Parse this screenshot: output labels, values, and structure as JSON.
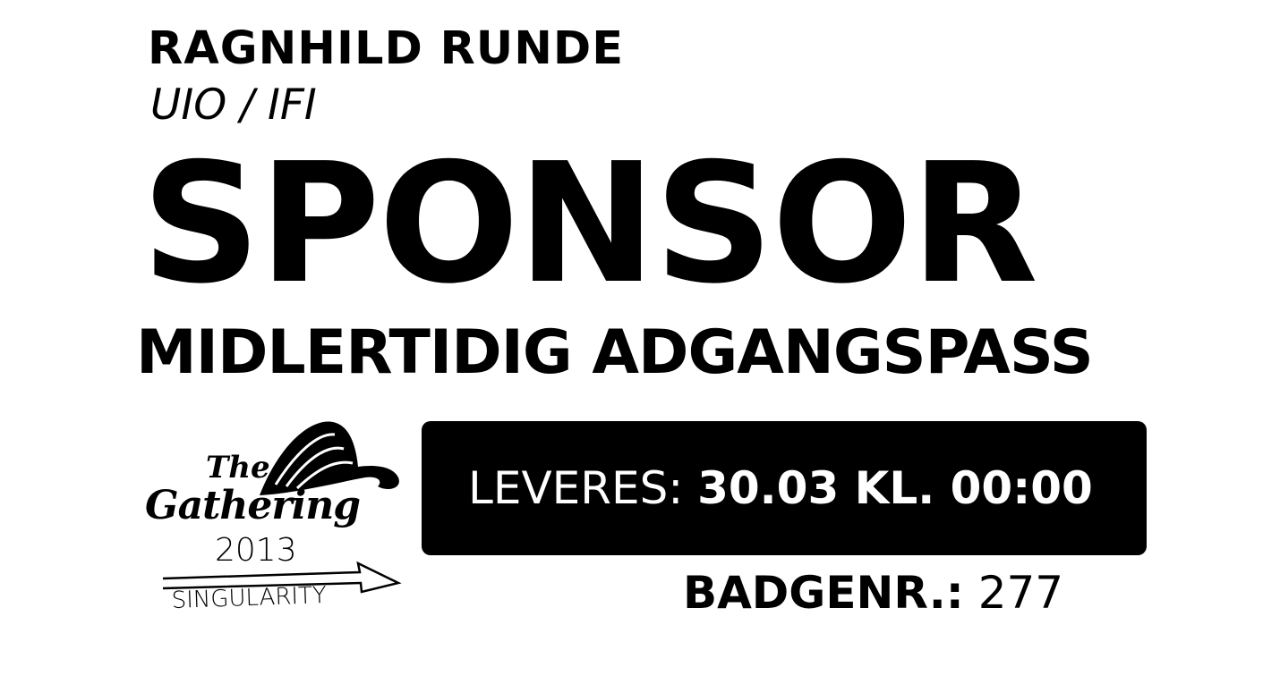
{
  "holder": {
    "name": "RAGNHILD RUNDE",
    "organization": "UIO / IFI"
  },
  "badge_type": "SPONSOR",
  "pass_type": "MIDLERTIDIG ADGANGSPASS",
  "delivery": {
    "label": "LEVERES:",
    "value": "30.03 KL. 00:00"
  },
  "badge_number": {
    "label": "BADGENR.:",
    "value": "277"
  },
  "logo": {
    "line1": "The",
    "line2": "Gathering",
    "year": "2013",
    "theme": "SINGULARITY",
    "icon": "gathering-logo-icon"
  },
  "colors": {
    "background": "#ffffff",
    "ink": "#000000",
    "box_text": "#ffffff"
  }
}
